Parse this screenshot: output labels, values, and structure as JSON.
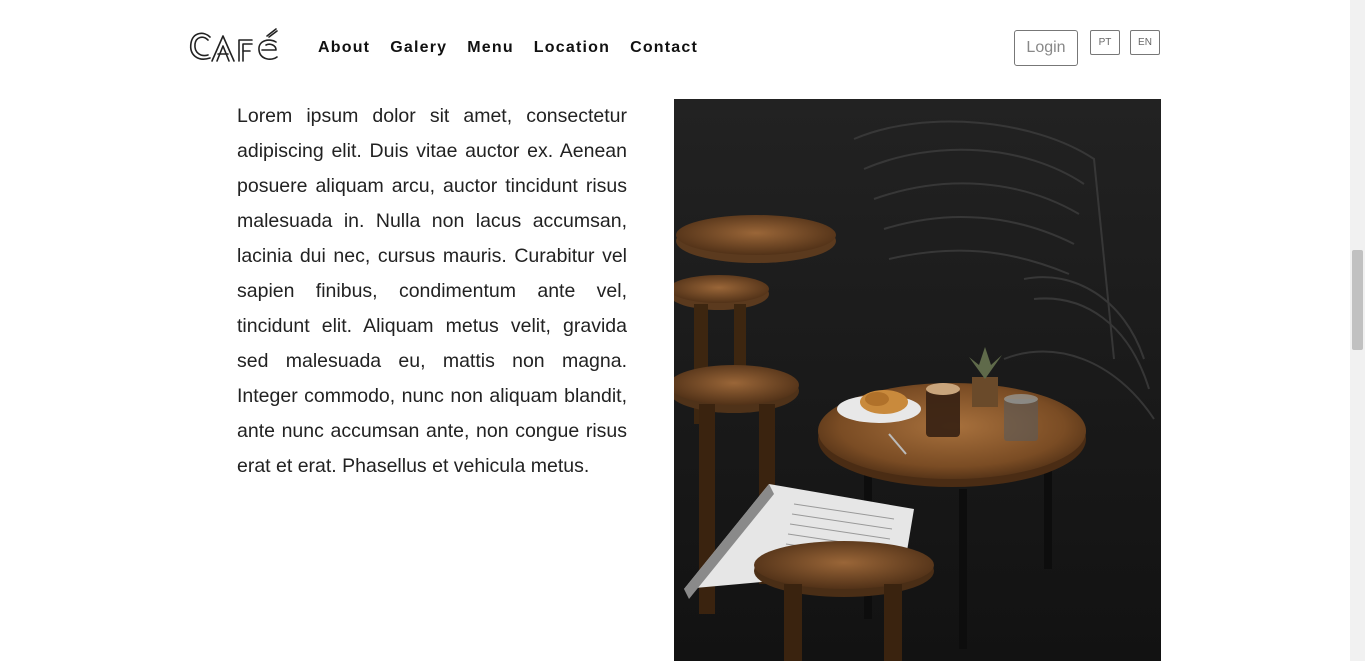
{
  "brand": {
    "logo_text": "Café"
  },
  "nav": {
    "items": [
      {
        "label": "About"
      },
      {
        "label": "Galery"
      },
      {
        "label": "Menu"
      },
      {
        "label": "Location"
      },
      {
        "label": "Contact"
      }
    ]
  },
  "header": {
    "login_label": "Login",
    "languages": [
      {
        "code": "PT"
      },
      {
        "code": "EN"
      }
    ]
  },
  "main": {
    "intro_text": "Lorem ipsum dolor sit amet, consectetur adipiscing elit. Duis vitae auctor ex. Aenean posuere aliquam arcu, auctor tincidunt risus malesuada in. Nulla non lacus accumsan, lacinia dui nec, cursus mauris. Curabitur vel sapien finibus, condimentum ante vel, tincidunt elit. Aliquam metus velit, gravida sed malesuada eu, mattis non magna. Integer commodo, nunc non aliquam blandit, ante nunc accumsan ante, non congue risus erat et erat. Phasellus et vehicula metus."
  },
  "colors": {
    "text": "#222222",
    "nav_text": "#111111",
    "button_border": "#777777",
    "photo_background": "#1a1a1a"
  }
}
